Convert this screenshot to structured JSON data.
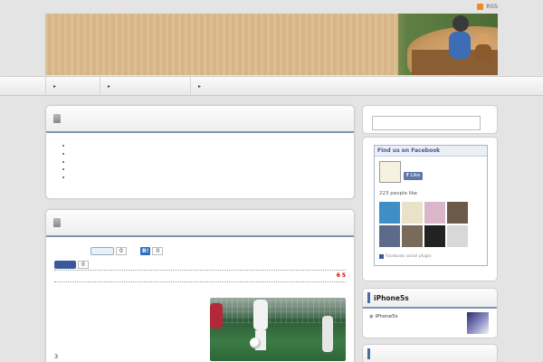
{
  "rss": {
    "label": "RSS"
  },
  "header": {
    "title": ""
  },
  "nav": {
    "items": [
      "",
      "",
      ""
    ]
  },
  "panel1": {
    "title": "",
    "links": [
      "",
      "",
      "",
      "",
      ""
    ]
  },
  "panel2": {
    "title": "",
    "share": {
      "tweet_label": "",
      "tweet_count": "0",
      "hatena_label": "B!",
      "hatena_count": "0",
      "fb_label": "",
      "fb_count": "0"
    },
    "meta": {
      "prefix": "",
      "day": "6",
      "month": "5"
    },
    "paragraphs": [
      {
        "a": "",
        "b": "",
        "c": ""
      },
      {
        "a": "",
        "b": "",
        "c": ""
      },
      {
        "a": "",
        "b": "",
        "c": ""
      },
      {
        "a": "",
        "b": "",
        "c": "3"
      }
    ]
  },
  "sidebar": {
    "search_placeholder": "",
    "facebook": {
      "title": "Find us on Facebook",
      "page_initial": "",
      "like_label": "Like",
      "likes_text": "223 people like",
      "likes_link": "",
      "plugin_label": "Facebook social plugin",
      "faces": [
        "#3f8fc4",
        "#e8e2c8",
        "#d9b7c8",
        "#6b5a4a",
        "#5c6b8a",
        "#7a6a5a",
        "#222222",
        "#d8d8d8"
      ]
    },
    "widget2": {
      "title": "iPhone5s",
      "item": "iPhone5s"
    },
    "widget3": {
      "title": ""
    }
  }
}
